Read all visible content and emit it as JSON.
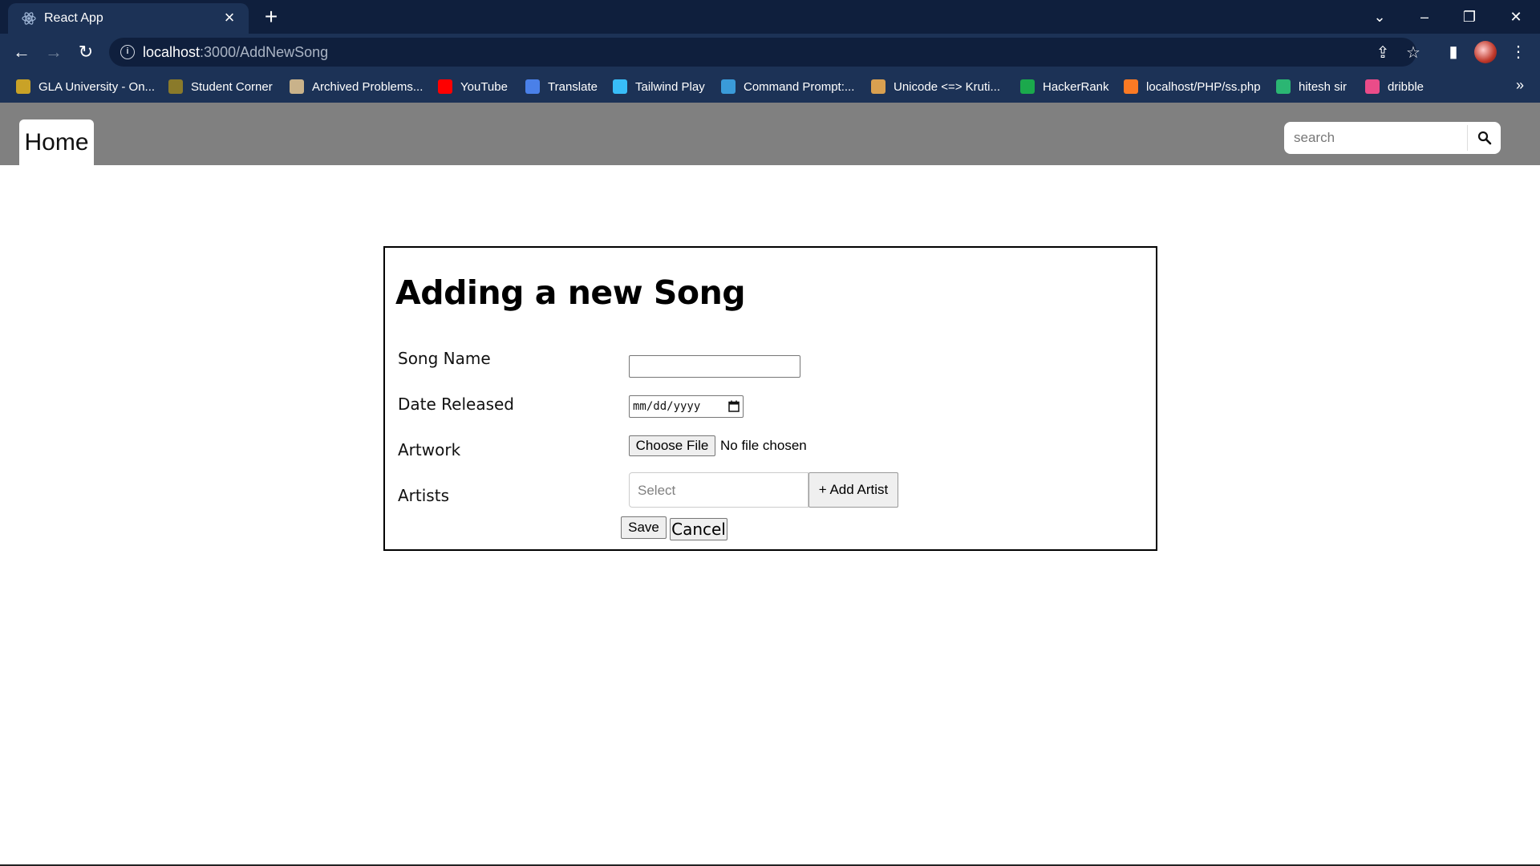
{
  "browser": {
    "tab_title": "React App",
    "url_host": "localhost",
    "url_rest": ":3000/AddNewSong",
    "bookmarks": [
      {
        "label": "GLA University - On...",
        "color": "#c9a227"
      },
      {
        "label": "Student Corner",
        "color": "#8a7a2a"
      },
      {
        "label": "Archived Problems...",
        "color": "#c9b28a"
      },
      {
        "label": "YouTube",
        "color": "#ff0000"
      },
      {
        "label": "Translate",
        "color": "#4a80e8"
      },
      {
        "label": "Tailwind Play",
        "color": "#38bdf8"
      },
      {
        "label": "Command Prompt:...",
        "color": "#3a9bd9"
      },
      {
        "label": "Unicode <=> Kruti...",
        "color": "#d9a050"
      },
      {
        "label": "HackerRank",
        "color": "#1ba94c"
      },
      {
        "label": "localhost/PHP/ss.php",
        "color": "#fb7a24"
      },
      {
        "label": "hitesh sir",
        "color": "#2bb673"
      },
      {
        "label": "dribble",
        "color": "#ea4c89"
      }
    ]
  },
  "navbar": {
    "home_label": "Home",
    "search_placeholder": "search"
  },
  "form": {
    "title": "Adding a new Song",
    "song_name_label": "Song Name",
    "date_label": "Date Released",
    "date_placeholder": "mm/dd/yyyy",
    "artwork_label": "Artwork",
    "file_button": "Choose File",
    "file_status": "No file chosen",
    "artists_label": "Artists",
    "artists_placeholder": "Select",
    "add_artist_button": "+ Add Artist",
    "save_button": "Save",
    "cancel_button": "Cancel"
  },
  "icons": {
    "tab_favicon": "react-icon",
    "search": "search-icon"
  }
}
